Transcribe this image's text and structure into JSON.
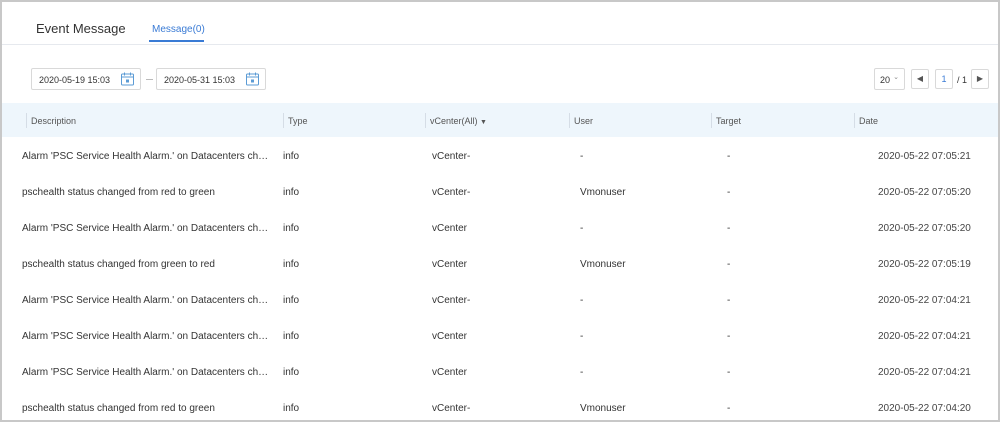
{
  "header": {
    "title": "Event Message",
    "tab_label": "Message(0)"
  },
  "filters": {
    "start_date": "2020-05-19 15:03",
    "end_date": "2020-05-31 15:03",
    "page_size": "20",
    "page_current": "1",
    "page_total": "/ 1"
  },
  "columns": {
    "description": "Description",
    "type": "Type",
    "vcenter": "vCenter(All)",
    "user": "User",
    "target": "Target",
    "date": "Date"
  },
  "rows": [
    {
      "description": "Alarm 'PSC Service Health Alarm.' on Datacenters changed from Gray to Green",
      "type": "info",
      "vcenter": "vCenter-",
      "user": "-",
      "target": "-",
      "date": "2020-05-22 07:05:21"
    },
    {
      "description": "pschealth status changed from red to green",
      "type": "info",
      "vcenter": "vCenter-",
      "user": "Vmonuser",
      "target": "-",
      "date": "2020-05-22 07:05:20"
    },
    {
      "description": "Alarm 'PSC Service Health Alarm.' on Datacenters changed from Gray to Green",
      "type": "info",
      "vcenter": "vCenter",
      "user": "-",
      "target": "-",
      "date": "2020-05-22 07:05:20"
    },
    {
      "description": "pschealth status changed from green to red",
      "type": "info",
      "vcenter": "vCenter",
      "user": "Vmonuser",
      "target": "-",
      "date": "2020-05-22 07:05:19"
    },
    {
      "description": "Alarm 'PSC Service Health Alarm.' on Datacenters changed from Gray to Green",
      "type": "info",
      "vcenter": "vCenter-",
      "user": "-",
      "target": "-",
      "date": "2020-05-22 07:04:21"
    },
    {
      "description": "Alarm 'PSC Service Health Alarm.' on Datacenters changed from Gray to Green",
      "type": "info",
      "vcenter": "vCenter",
      "user": "-",
      "target": "-",
      "date": "2020-05-22 07:04:21"
    },
    {
      "description": "Alarm 'PSC Service Health Alarm.' on Datacenters changed from Gray to Green",
      "type": "info",
      "vcenter": "vCenter",
      "user": "-",
      "target": "-",
      "date": "2020-05-22 07:04:21"
    },
    {
      "description": "pschealth status changed from red to green",
      "type": "info",
      "vcenter": "vCenter-",
      "user": "Vmonuser",
      "target": "-",
      "date": "2020-05-22 07:04:20"
    }
  ],
  "colors": {
    "accent": "#3a7bd5",
    "header_bg": "#eef6fc"
  },
  "icons": {
    "calendar": "calendar-icon",
    "sort": "caret-down-icon",
    "prev": "chevron-left-icon",
    "next": "chevron-right-icon"
  }
}
